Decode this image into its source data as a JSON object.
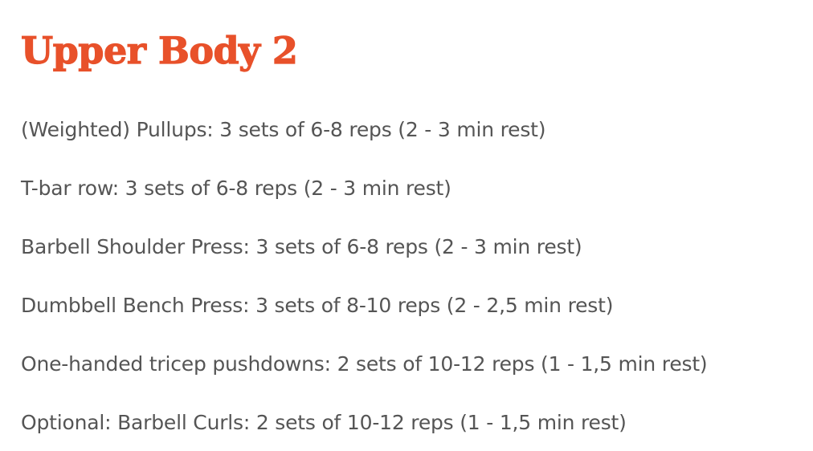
{
  "title": "Upper Body 2",
  "exercises": [
    "(Weighted) Pullups: 3 sets of 6-8 reps (2 - 3 min rest)",
    "T-bar row: 3 sets of 6-8 reps (2 - 3 min rest)",
    "Barbell Shoulder Press: 3 sets of 6-8 reps (2 - 3 min rest)",
    "Dumbbell Bench Press: 3 sets of 8-10 reps (2 - 2,5 min rest)",
    "One-handed tricep pushdowns: 2 sets of 10-12 reps (1 - 1,5 min rest)",
    "Optional: Barbell Curls: 2 sets of 10-12 reps (1 - 1,5 min rest)"
  ],
  "colors": {
    "title": "#e8512a",
    "body_text": "#555555",
    "background": "#ffffff"
  }
}
